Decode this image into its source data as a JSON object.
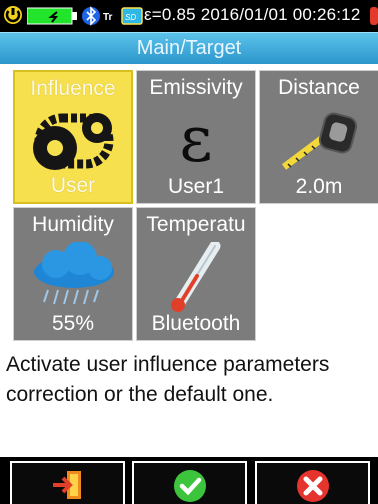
{
  "status": {
    "text": "ε=0.85  2016/01/01 00:26:12"
  },
  "header": {
    "title": "Main/Target"
  },
  "tiles": [
    {
      "label": "Influence",
      "value": "User",
      "icon": "chain-gears-icon"
    },
    {
      "label": "Emissivity",
      "value": "User1",
      "symbol": "ε",
      "icon": "epsilon-icon"
    },
    {
      "label": "Distance",
      "value": "2.0m",
      "icon": "tape-measure-icon"
    },
    {
      "label": "Humidity",
      "value": "55%",
      "icon": "rain-cloud-icon"
    },
    {
      "label": "Temperatu",
      "value": "Bluetooth",
      "icon": "thermometer-icon"
    }
  ],
  "description": "Activate user influence parameters correction or the default one.",
  "bottom": [
    {
      "name": "exit-button",
      "icon": "exit-icon"
    },
    {
      "name": "confirm-button",
      "icon": "checkmark-icon"
    },
    {
      "name": "cancel-button",
      "icon": "cancel-icon"
    }
  ],
  "colors": {
    "selected": "#f7e04d",
    "tile": "#7c7c7c",
    "header": "#3aa7d8"
  }
}
